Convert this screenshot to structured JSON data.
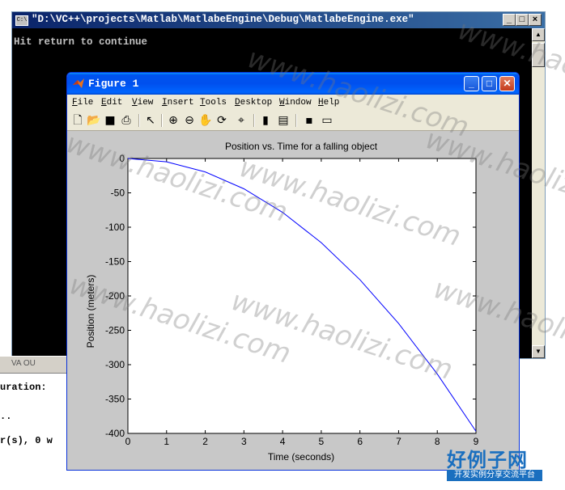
{
  "console": {
    "title": "\"D:\\VC++\\projects\\Matlab\\MatlabeEngine\\Debug\\MatlabeEngine.exe\"",
    "prompt": "Hit return to continue",
    "buttons": [
      "_",
      "□",
      "×"
    ]
  },
  "background": {
    "line1": "uration:",
    "line2": "..",
    "line3": "r(s), 0 w",
    "tab_label": "VA OU"
  },
  "figure": {
    "title": "Figure 1",
    "menu": [
      {
        "u": "F",
        "rest": "ile"
      },
      {
        "u": "E",
        "rest": "dit"
      },
      {
        "u": "V",
        "rest": "iew"
      },
      {
        "u": "I",
        "rest": "nsert"
      },
      {
        "u": "T",
        "rest": "ools"
      },
      {
        "u": "D",
        "rest": "esktop"
      },
      {
        "u": "W",
        "rest": "indow"
      },
      {
        "u": "H",
        "rest": "elp"
      }
    ],
    "toolbar_icons": [
      "new-file-icon",
      "open-folder-icon",
      "save-icon",
      "print-icon",
      "pointer-icon",
      "zoom-in-icon",
      "zoom-out-icon",
      "pan-hand-icon",
      "rotate-3d-icon",
      "data-cursor-icon",
      "colorbar-icon",
      "legend-icon",
      "hide-plot-tools-icon",
      "show-plot-tools-icon"
    ]
  },
  "chart_data": {
    "type": "line",
    "title": "Position vs. Time for a falling object",
    "xlabel": "Time (seconds)",
    "ylabel": "Position (meters)",
    "xlim": [
      0,
      9
    ],
    "ylim": [
      -400,
      0
    ],
    "xticks": [
      0,
      1,
      2,
      3,
      4,
      5,
      6,
      7,
      8,
      9
    ],
    "yticks": [
      0,
      -50,
      -100,
      -150,
      -200,
      -250,
      -300,
      -350,
      -400
    ],
    "grid": false,
    "series": [
      {
        "color": "#0000ff",
        "x": [
          0,
          1,
          2,
          3,
          4,
          5,
          6,
          7,
          8,
          9
        ],
        "y": [
          0,
          -4.9,
          -19.6,
          -44.1,
          -78.4,
          -122.5,
          -176.4,
          -240.1,
          -313.6,
          -396.9
        ]
      }
    ]
  },
  "watermark": "www.haolizi.com",
  "site_logo": {
    "main": "好例子网",
    "sub": "开发实例分享交流平台"
  }
}
